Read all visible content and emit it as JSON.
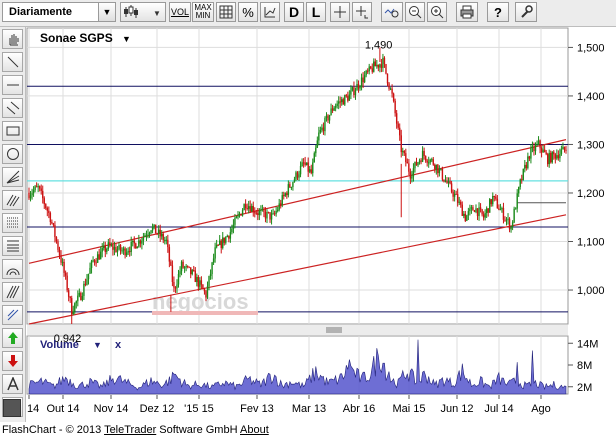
{
  "toolbar": {
    "period_select": "Diariamente",
    "vol_label": "VOL",
    "maxmin_top": "MAX",
    "maxmin_bottom": "MIN",
    "percent_label": "%",
    "d_label": "D",
    "l_label": "L",
    "help_label": "?"
  },
  "chart": {
    "instrument": "Sonae SGPS",
    "volume_label": "Volume",
    "close_symbol": "x",
    "watermark": "negocios",
    "colors": {
      "up": "#1a8a1a",
      "down": "#cc1111",
      "volume": "#5555cc",
      "trend": "#cc2222",
      "hline": "#101060",
      "cyan": "#66e0e0"
    }
  },
  "chart_data": {
    "type": "candlestick",
    "price_axis": {
      "ticks": [
        "1,500",
        "1,400",
        "1,300",
        "1,200",
        "1,100",
        "1,000"
      ],
      "tick_values": [
        1.5,
        1.4,
        1.3,
        1.2,
        1.1,
        1.0
      ],
      "ylim": [
        0.93,
        1.54
      ]
    },
    "volume_axis": {
      "ticks": [
        "14M",
        "8M",
        "2M"
      ],
      "tick_values": [
        14,
        8,
        2
      ],
      "ylim": [
        0,
        16
      ]
    },
    "x_ticks": [
      "14",
      "Out 14",
      "Nov 14",
      "Dez 12",
      "'15 15",
      "Fev 13",
      "Mar 13",
      "Abr 16",
      "Mai 15",
      "Jun 12",
      "Jul 14",
      "Ago"
    ],
    "annotations": [
      {
        "label": "1,490",
        "value": 1.49
      },
      {
        "label": "0,942",
        "value": 0.942
      }
    ],
    "horizontal_lines": [
      1.42,
      1.3,
      1.13,
      0.955
    ],
    "cyan_line": 1.225,
    "short_line": 1.18,
    "price_path": [
      [
        0,
        1.2
      ],
      [
        6,
        1.21
      ],
      [
        14,
        1.15
      ],
      [
        22,
        1.05
      ],
      [
        28,
        0.96
      ],
      [
        34,
        0.99
      ],
      [
        42,
        1.06
      ],
      [
        52,
        1.09
      ],
      [
        62,
        1.08
      ],
      [
        72,
        1.1
      ],
      [
        80,
        1.13
      ],
      [
        90,
        1.1
      ],
      [
        95,
        1.0
      ],
      [
        100,
        1.05
      ],
      [
        108,
        1.03
      ],
      [
        116,
        0.99
      ],
      [
        122,
        1.08
      ],
      [
        132,
        1.12
      ],
      [
        142,
        1.18
      ],
      [
        150,
        1.16
      ],
      [
        160,
        1.15
      ],
      [
        170,
        1.21
      ],
      [
        180,
        1.26
      ],
      [
        185,
        1.24
      ],
      [
        190,
        1.32
      ],
      [
        200,
        1.38
      ],
      [
        210,
        1.4
      ],
      [
        220,
        1.44
      ],
      [
        226,
        1.46
      ],
      [
        232,
        1.47
      ],
      [
        238,
        1.4
      ],
      [
        244,
        1.29
      ],
      [
        250,
        1.24
      ],
      [
        258,
        1.28
      ],
      [
        266,
        1.26
      ],
      [
        274,
        1.22
      ],
      [
        280,
        1.19
      ],
      [
        286,
        1.15
      ],
      [
        292,
        1.17
      ],
      [
        298,
        1.15
      ],
      [
        304,
        1.19
      ],
      [
        310,
        1.16
      ],
      [
        316,
        1.13
      ],
      [
        322,
        1.22
      ],
      [
        328,
        1.28
      ],
      [
        334,
        1.3
      ],
      [
        340,
        1.27
      ],
      [
        346,
        1.28
      ],
      [
        352,
        1.29
      ]
    ],
    "volume_path": [
      [
        0,
        2.5
      ],
      [
        8,
        3.4
      ],
      [
        16,
        2.1
      ],
      [
        24,
        4.5
      ],
      [
        32,
        2.2
      ],
      [
        40,
        3.2
      ],
      [
        48,
        2.0
      ],
      [
        56,
        4.6
      ],
      [
        64,
        3.0
      ],
      [
        72,
        1.8
      ],
      [
        80,
        3.6
      ],
      [
        88,
        2.5
      ],
      [
        96,
        5.0
      ],
      [
        104,
        2.2
      ],
      [
        112,
        2.7
      ],
      [
        120,
        1.9
      ],
      [
        128,
        3.1
      ],
      [
        136,
        2.0
      ],
      [
        144,
        4.0
      ],
      [
        152,
        2.5
      ],
      [
        160,
        5.5
      ],
      [
        166,
        2.3
      ],
      [
        172,
        3.4
      ],
      [
        180,
        2.1
      ],
      [
        188,
        6.0
      ],
      [
        196,
        3.0
      ],
      [
        204,
        4.2
      ],
      [
        210,
        7.2
      ],
      [
        218,
        4.0
      ],
      [
        224,
        5.6
      ],
      [
        230,
        11.5
      ],
      [
        236,
        4.2
      ],
      [
        242,
        2.9
      ],
      [
        248,
        6.4
      ],
      [
        254,
        3.2
      ],
      [
        260,
        5.5
      ],
      [
        266,
        2.4
      ],
      [
        272,
        4.0
      ],
      [
        278,
        2.8
      ],
      [
        284,
        6.2
      ],
      [
        290,
        2.6
      ],
      [
        296,
        3.4
      ],
      [
        302,
        2.0
      ],
      [
        308,
        4.2
      ],
      [
        314,
        2.6
      ],
      [
        320,
        3.6
      ],
      [
        326,
        2.1
      ],
      [
        332,
        2.9
      ],
      [
        338,
        1.9
      ],
      [
        344,
        2.5
      ],
      [
        352,
        1.8
      ]
    ],
    "volume_spikes": [
      [
        95,
        5.5
      ],
      [
        210,
        9.5
      ],
      [
        236,
        6.2
      ],
      [
        255,
        15.0
      ],
      [
        320,
        8.8
      ],
      [
        330,
        12.0
      ]
    ]
  },
  "footer": {
    "prefix": "FlashChart - © 2013 ",
    "company": "TeleTrader",
    "suffix": " Software GmbH ",
    "about": "About"
  }
}
